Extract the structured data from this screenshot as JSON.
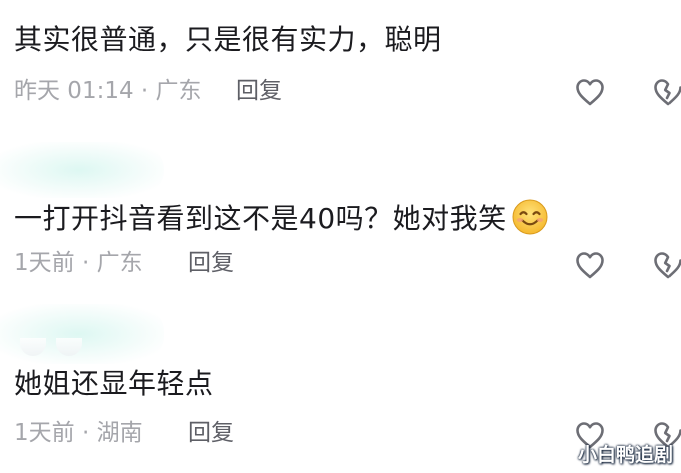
{
  "comments": [
    {
      "text": "其实很普通，只是很有实力，聪明",
      "meta": "昨天 01:14 · 广东",
      "reply": "回复"
    },
    {
      "text": "一打开抖音看到这不是40吗？她对我笑",
      "emoji": "smiling-face-emoji",
      "meta": "1天前 · 广东",
      "reply": "回复"
    },
    {
      "text": "她姐还显年轻点",
      "meta": "1天前 · 湖南",
      "reply": "回复"
    }
  ],
  "icons": {
    "like": "heart-outline-icon",
    "dislike": "broken-heart-outline-icon"
  },
  "colors": {
    "text": "#1b1b1f",
    "meta": "#a5a6ab",
    "reply": "#5e5f66",
    "icon": "#6d6e75"
  },
  "watermark": "小白鸭追剧"
}
